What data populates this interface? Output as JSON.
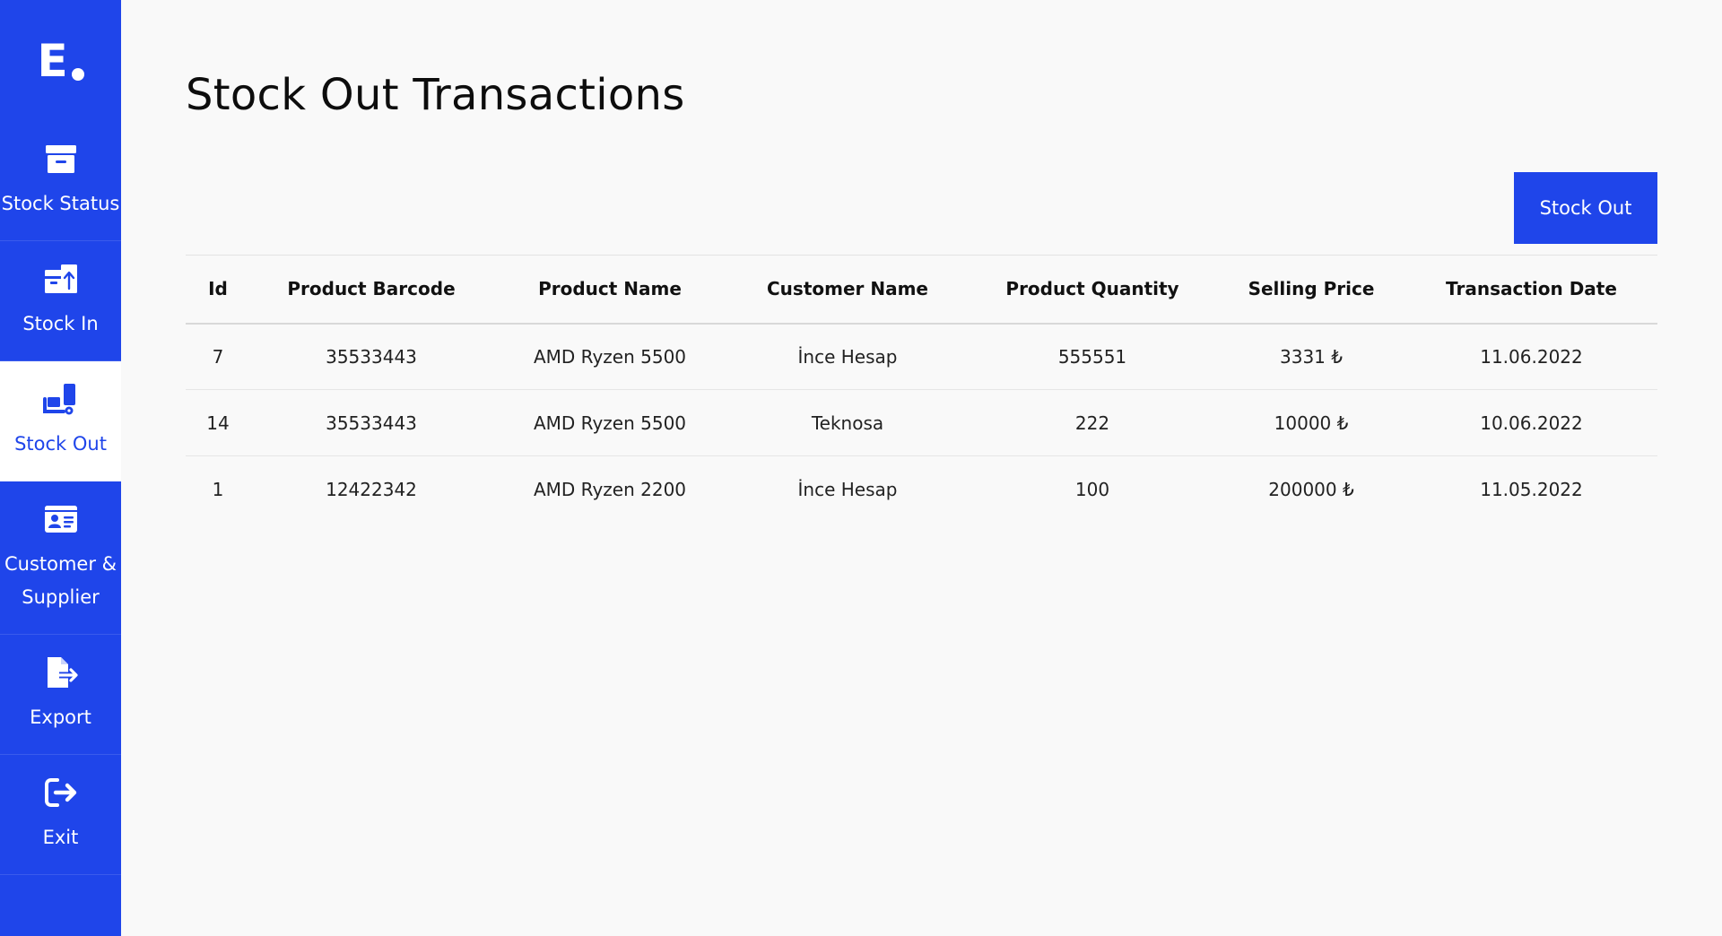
{
  "brand": {
    "logo_letter": "E"
  },
  "sidebar": {
    "items": [
      {
        "label": "Stock Status",
        "icon": "archive-icon",
        "active": false
      },
      {
        "label": "Stock In",
        "icon": "box-arrow-up-icon",
        "active": false
      },
      {
        "label": "Stock Out",
        "icon": "dolly-icon",
        "active": true
      },
      {
        "label": "Customer &\nSupplier",
        "icon": "id-card-icon",
        "active": false
      },
      {
        "label": "Export",
        "icon": "file-export-icon",
        "active": false
      },
      {
        "label": "Exit",
        "icon": "sign-out-icon",
        "active": false
      }
    ]
  },
  "page": {
    "title": "Stock Out Transactions"
  },
  "toolbar": {
    "stock_out_label": "Stock Out"
  },
  "table": {
    "headers": [
      "Id",
      "Product Barcode",
      "Product Name",
      "Customer Name",
      "Product Quantity",
      "Selling Price",
      "Transaction Date"
    ],
    "rows": [
      [
        "7",
        "35533443",
        "AMD Ryzen 5500",
        "İnce Hesap",
        "555551",
        "3331 ₺",
        "11.06.2022"
      ],
      [
        "14",
        "35533443",
        "AMD Ryzen 5500",
        "Teknosa",
        "222",
        "10000 ₺",
        "10.06.2022"
      ],
      [
        "1",
        "12422342",
        "AMD Ryzen 2200",
        "İnce Hesap",
        "100",
        "200000 ₺",
        "11.05.2022"
      ]
    ]
  },
  "colors": {
    "accent": "#1f45ea",
    "background": "#f9f9f9",
    "active_bg": "#ffffff"
  }
}
